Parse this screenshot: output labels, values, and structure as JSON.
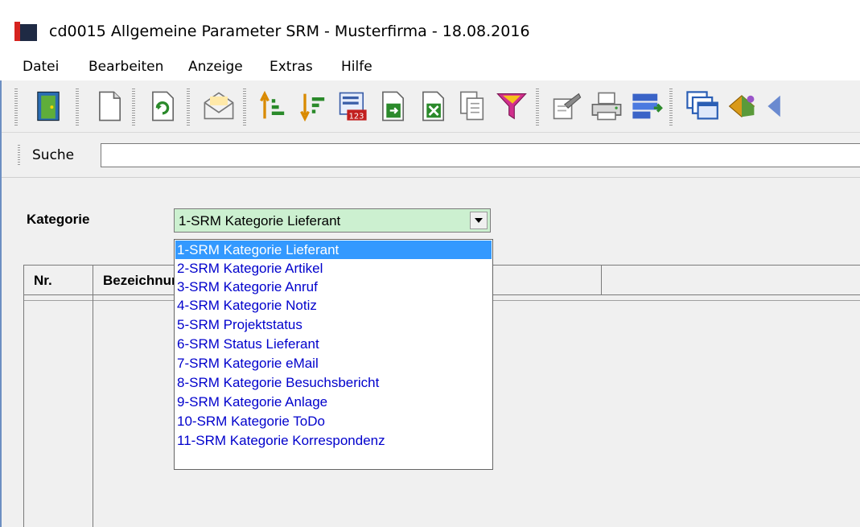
{
  "window": {
    "title": "cd0015 Allgemeine Parameter SRM - Musterfirma - 18.08.2016"
  },
  "menu": [
    "Datei",
    "Bearbeiten",
    "Anzeige",
    "Extras",
    "Hilfe"
  ],
  "toolbar": {
    "icons": [
      "exit-door-icon",
      "new-document-icon",
      "refresh-icon",
      "mail-icon",
      "sort-ascending-icon",
      "sort-descending-icon",
      "calculator-icon",
      "export-icon",
      "excel-icon",
      "copy-icon",
      "filter-icon",
      "settings-icon",
      "print-icon",
      "transfer-icon",
      "windows-icon",
      "tools-icon"
    ]
  },
  "search": {
    "label": "Suche",
    "value": ""
  },
  "category": {
    "label": "Kategorie",
    "selected": "1-SRM Kategorie Lieferant",
    "options": [
      "1-SRM Kategorie Lieferant",
      "2-SRM Kategorie Artikel",
      "3-SRM Kategorie Anruf",
      "4-SRM Kategorie Notiz",
      "5-SRM Projektstatus",
      "6-SRM Status Lieferant",
      "7-SRM Kategorie eMail",
      "8-SRM Kategorie Besuchsbericht",
      "9-SRM Kategorie Anlage",
      "10-SRM Kategorie ToDo",
      "11-SRM Kategorie Korrespondenz"
    ]
  },
  "grid": {
    "columns": [
      "Nr.",
      "Bezeichnung",
      ""
    ]
  },
  "colors": {
    "select_bg": "#ccf0d0",
    "highlight": "#3399ff",
    "option_text": "#0000cc"
  }
}
